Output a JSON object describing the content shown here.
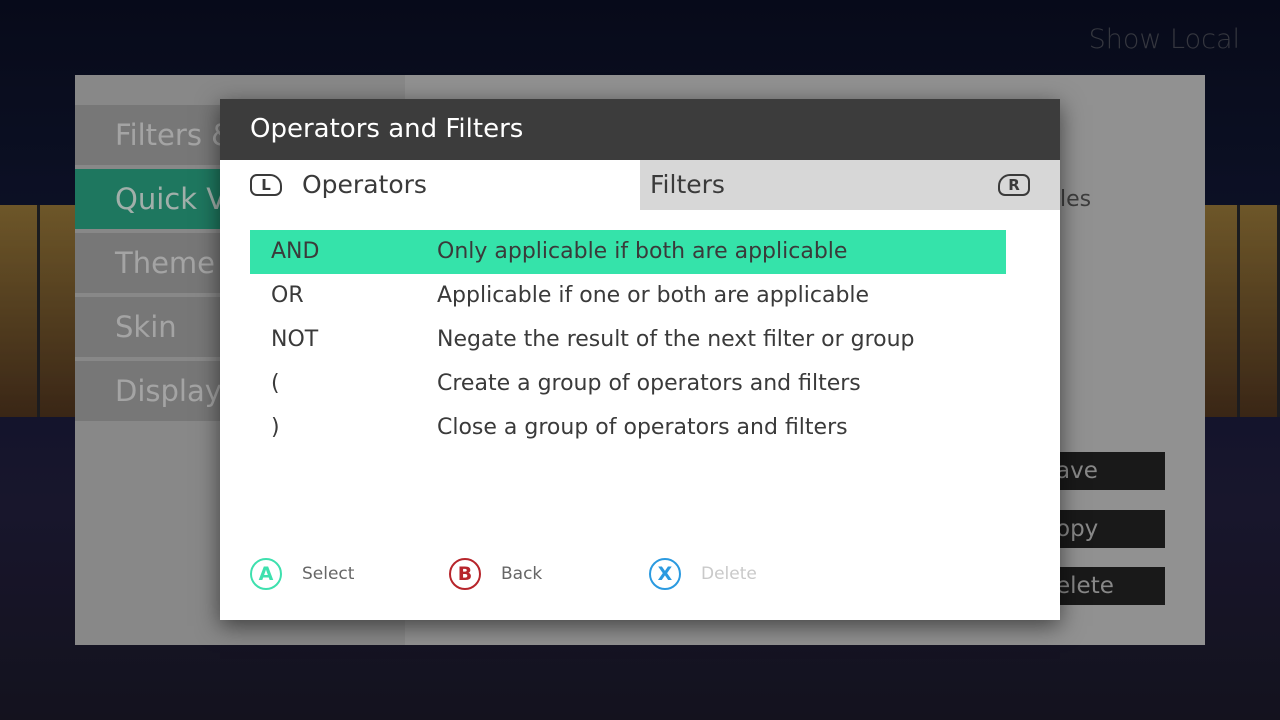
{
  "background": {
    "show_local_label": "Show Local",
    "nav_items": [
      {
        "label": "Filters & Sorts",
        "active": false
      },
      {
        "label": "Quick Views",
        "active": true
      },
      {
        "label": "Theme",
        "active": false
      },
      {
        "label": "Skin",
        "active": false
      },
      {
        "label": "Display",
        "active": false
      }
    ],
    "right_partial_text": "les",
    "buttons": [
      "ave",
      "opy",
      "elete"
    ]
  },
  "dialog": {
    "title": "Operators and Filters",
    "tabs": [
      {
        "label": "Operators",
        "bumper": "L",
        "active": true
      },
      {
        "label": "Filters",
        "bumper": "R",
        "active": false
      }
    ],
    "operators": [
      {
        "op": "AND",
        "desc": "Only applicable if both are applicable",
        "selected": true
      },
      {
        "op": "OR",
        "desc": "Applicable if one or both are applicable",
        "selected": false
      },
      {
        "op": "NOT",
        "desc": "Negate the result of the next filter or group",
        "selected": false
      },
      {
        "op": "(",
        "desc": "Create a group of operators and filters",
        "selected": false
      },
      {
        "op": ")",
        "desc": "Close a group of operators and filters",
        "selected": false
      }
    ],
    "legend": [
      {
        "button": "A",
        "label": "Select",
        "enabled": true
      },
      {
        "button": "B",
        "label": "Back",
        "enabled": true
      },
      {
        "button": "X",
        "label": "Delete",
        "enabled": false
      }
    ]
  },
  "colors": {
    "accent": "#35e3aa",
    "header": "#3c3c3c",
    "a_button": "#3ee0ae",
    "b_button": "#b7252b",
    "x_button": "#2b9ae0"
  }
}
